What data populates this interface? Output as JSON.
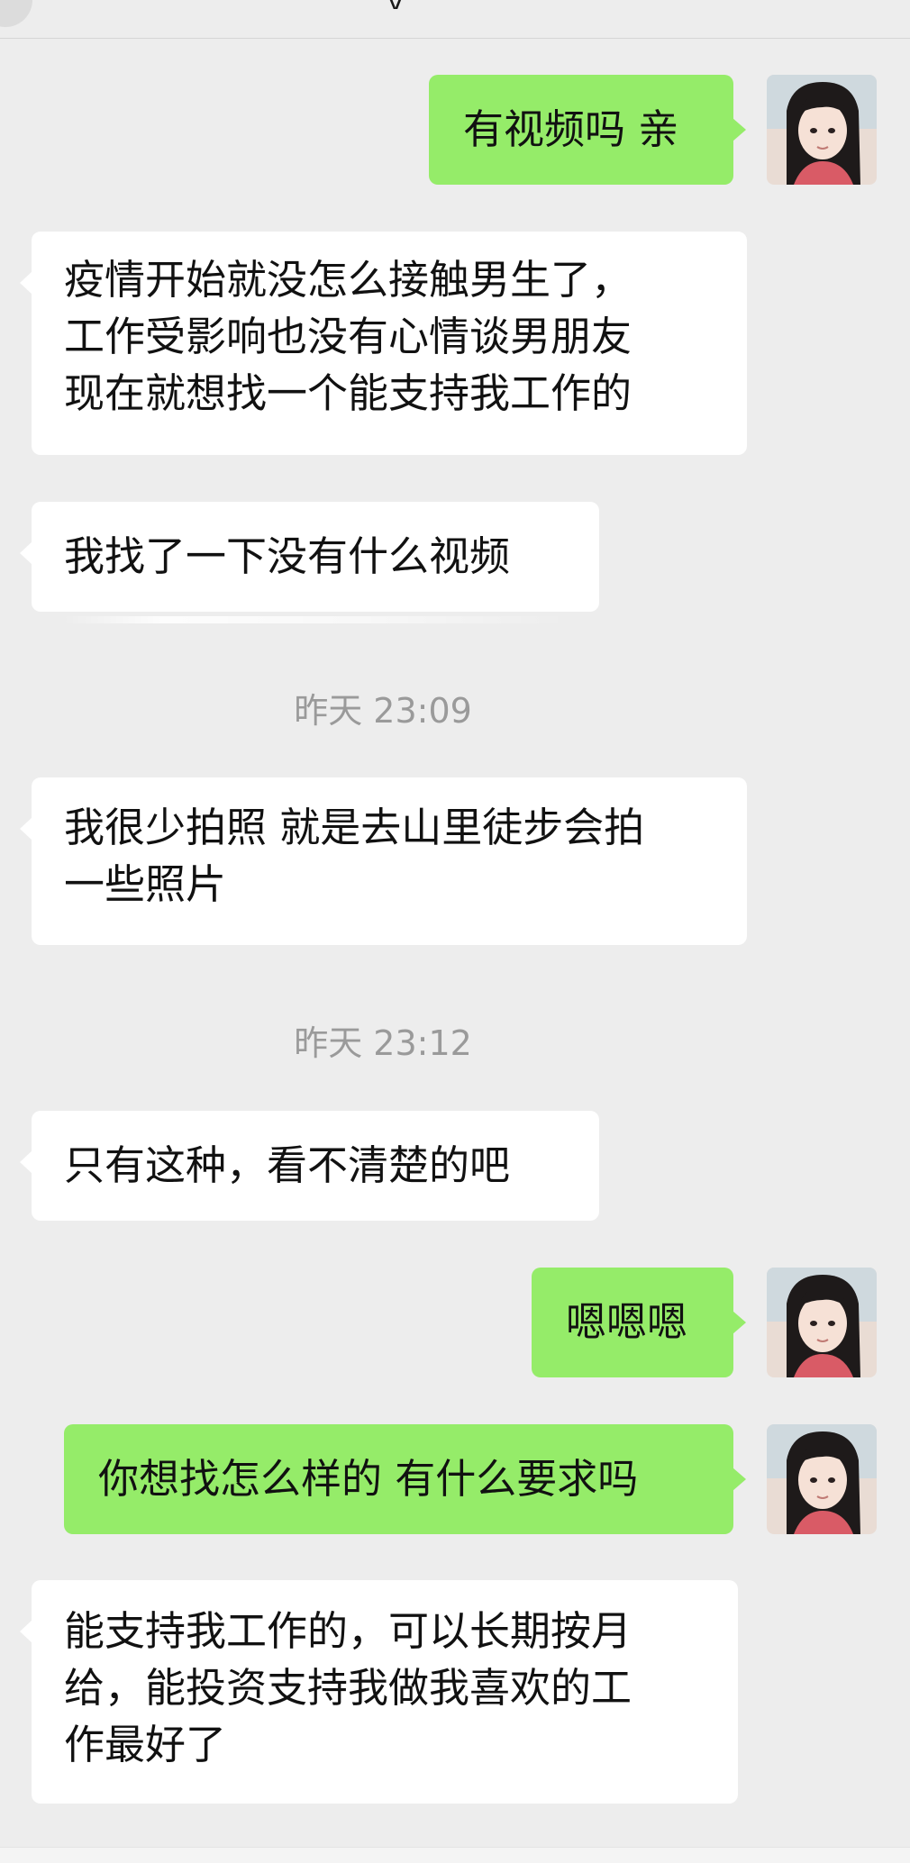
{
  "header": {
    "title_fragment": "y"
  },
  "messages": [
    {
      "side": "right",
      "text": "有视频吗 亲"
    },
    {
      "side": "left",
      "text": "疫情开始就没怎么接触男生了，\n工作受影响也没有心情谈男朋友\n现在就想找一个能支持我工作的"
    },
    {
      "side": "left",
      "text": "我找了一下没有什么视频"
    },
    {
      "side": "left",
      "text": "我很少拍照 就是去山里徒步会拍\n一些照片"
    },
    {
      "side": "left",
      "text": "只有这种，看不清楚的吧"
    },
    {
      "side": "right",
      "text": "嗯嗯嗯"
    },
    {
      "side": "right",
      "text": "你想找怎么样的 有什么要求吗"
    },
    {
      "side": "left",
      "text": "能支持我工作的，可以长期按月\n给，能投资支持我做我喜欢的工\n作最好了"
    }
  ],
  "timestamps": [
    "昨天 23:09",
    "昨天 23:12"
  ],
  "colors": {
    "background": "#ededed",
    "bubble_sent": "#95ec69",
    "bubble_received": "#ffffff",
    "timestamp_text": "#9a9a9a"
  }
}
